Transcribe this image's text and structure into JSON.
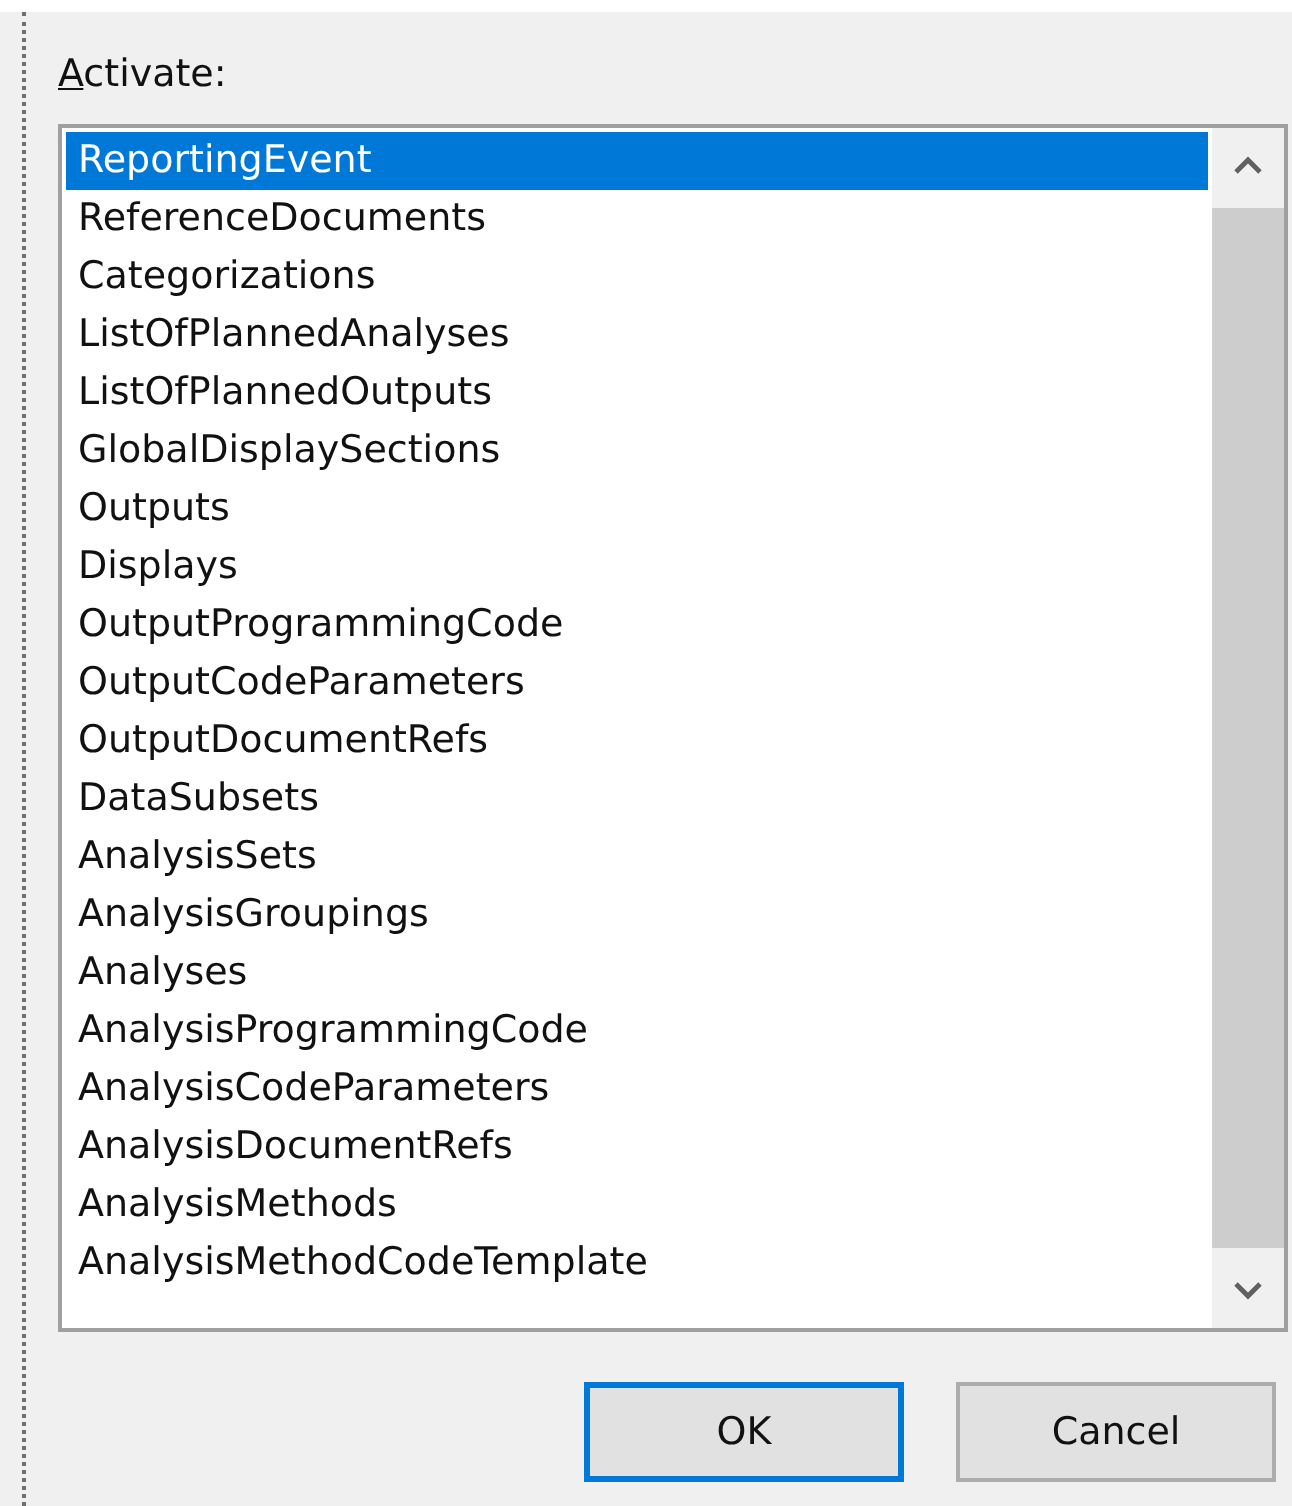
{
  "label": "Activate:",
  "list": {
    "items": [
      {
        "text": "ReportingEvent",
        "selected": true
      },
      {
        "text": "ReferenceDocuments",
        "selected": false
      },
      {
        "text": "Categorizations",
        "selected": false
      },
      {
        "text": "ListOfPlannedAnalyses",
        "selected": false
      },
      {
        "text": "ListOfPlannedOutputs",
        "selected": false
      },
      {
        "text": "GlobalDisplaySections",
        "selected": false
      },
      {
        "text": "Outputs",
        "selected": false
      },
      {
        "text": "Displays",
        "selected": false
      },
      {
        "text": "OutputProgrammingCode",
        "selected": false
      },
      {
        "text": "OutputCodeParameters",
        "selected": false
      },
      {
        "text": "OutputDocumentRefs",
        "selected": false
      },
      {
        "text": "DataSubsets",
        "selected": false
      },
      {
        "text": "AnalysisSets",
        "selected": false
      },
      {
        "text": "AnalysisGroupings",
        "selected": false
      },
      {
        "text": "Analyses",
        "selected": false
      },
      {
        "text": "AnalysisProgrammingCode",
        "selected": false
      },
      {
        "text": "AnalysisCodeParameters",
        "selected": false
      },
      {
        "text": "AnalysisDocumentRefs",
        "selected": false
      },
      {
        "text": "AnalysisMethods",
        "selected": false
      },
      {
        "text": "AnalysisMethodCodeTemplate",
        "selected": false
      }
    ]
  },
  "buttons": [
    {
      "label": "OK",
      "focused": true
    },
    {
      "label": "Cancel",
      "focused": false
    }
  ]
}
